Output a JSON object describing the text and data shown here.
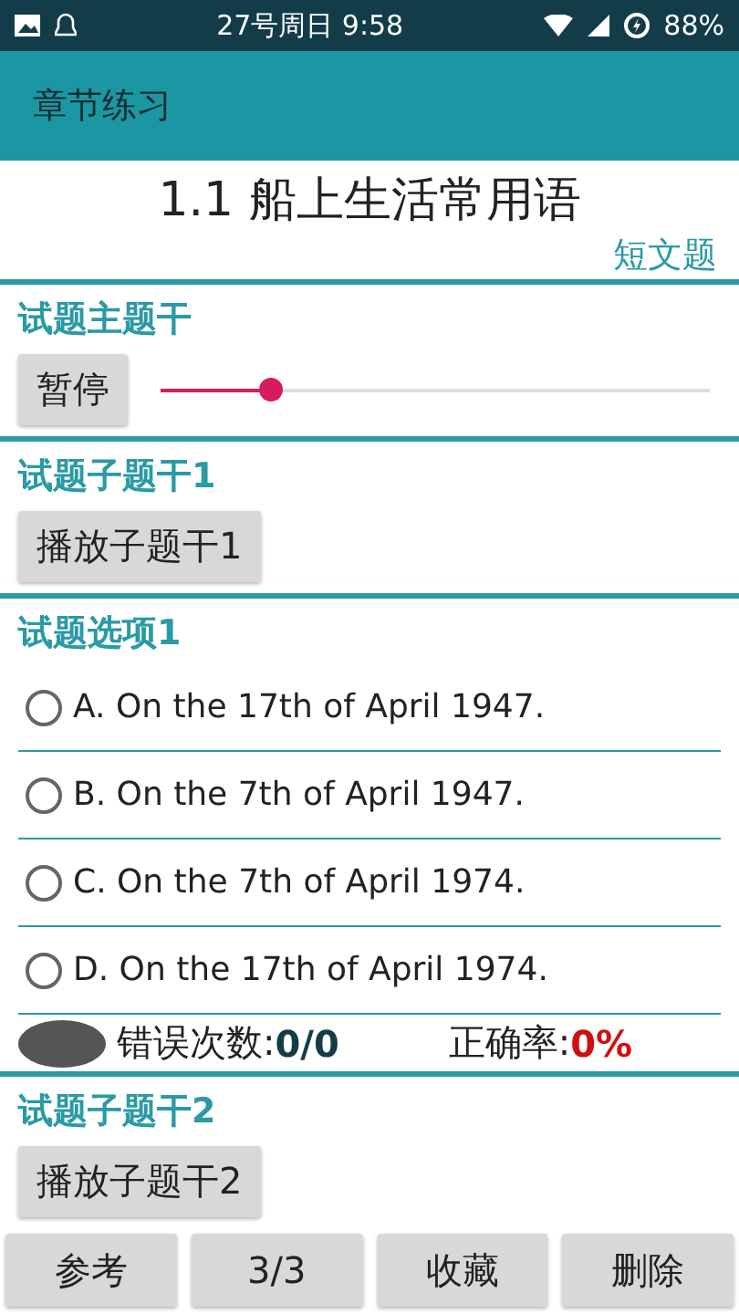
{
  "status_bar": {
    "time": "27号周日 9:58",
    "battery": "88%"
  },
  "app_bar": {
    "title": "章节练习"
  },
  "lesson": {
    "title": "1.1 船上生活常用语",
    "type": "短文题"
  },
  "main_stem": {
    "heading": "试题主题干",
    "button": "暂停",
    "level": 0.2
  },
  "sub_stem_1": {
    "heading": "试题子题干1",
    "button": "播放子题干1"
  },
  "options": {
    "heading": "试题选项1",
    "items": [
      {
        "label": "A. On the 17th of April 1947.",
        "selected": false
      },
      {
        "label": "B. On the 7th of April 1947.",
        "selected": false
      },
      {
        "label": "C. On the 7th of April 1974.",
        "selected": false
      },
      {
        "label": "D. On the 17th of April 1974.",
        "selected": false
      }
    ]
  },
  "stats": {
    "errors_label": "错误次数:",
    "errors_value": "0/0",
    "accuracy_label": "正确率:",
    "accuracy_value": "0%"
  },
  "sub_stem_2": {
    "heading": "试题子题干2",
    "button": "播放子题干2"
  },
  "bottom_buttons": [
    "参考",
    "3/3",
    "收藏",
    "删除"
  ]
}
